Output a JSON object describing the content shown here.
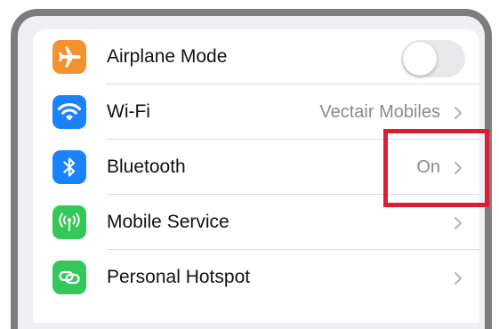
{
  "settings": {
    "rows": [
      {
        "label": "Airplane Mode",
        "value": "",
        "icon": "airplane-icon",
        "icon_color": "#f5922f",
        "control": "toggle",
        "toggle_on": false
      },
      {
        "label": "Wi-Fi",
        "value": "Vectair Mobiles",
        "icon": "wifi-icon",
        "icon_color": "#1a82fb",
        "control": "chevron"
      },
      {
        "label": "Bluetooth",
        "value": "On",
        "icon": "bluetooth-icon",
        "icon_color": "#1a82fb",
        "control": "chevron"
      },
      {
        "label": "Mobile Service",
        "value": "",
        "icon": "antenna-icon",
        "icon_color": "#34c759",
        "control": "chevron"
      },
      {
        "label": "Personal Hotspot",
        "value": "",
        "icon": "hotspot-link-icon",
        "icon_color": "#34c759",
        "control": "chevron"
      }
    ]
  },
  "annotation": {
    "highlight_color": "#dc1e35",
    "highlighted_item": "Bluetooth value"
  }
}
